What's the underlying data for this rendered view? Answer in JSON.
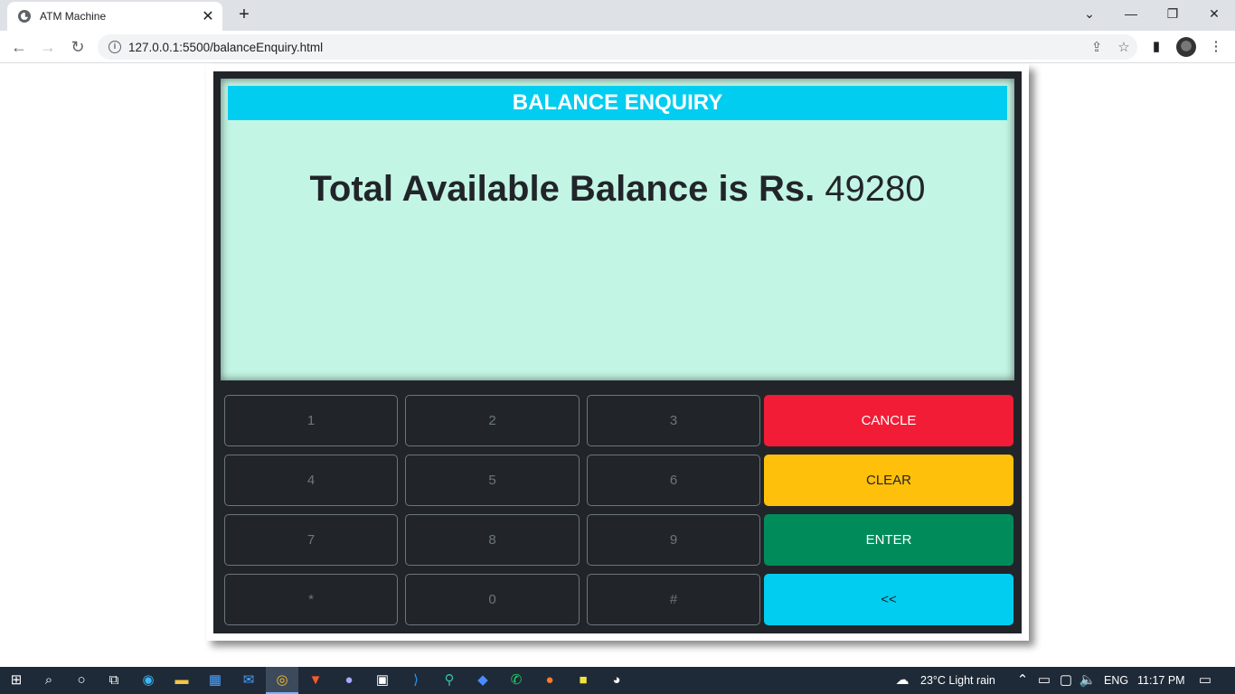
{
  "browser": {
    "tab_title": "ATM Machine",
    "url": "127.0.0.1:5500/balanceEnquiry.html"
  },
  "screen": {
    "title": "BALANCE ENQUIRY",
    "balance_label": "Total Available Balance is Rs.",
    "balance_value": "49280"
  },
  "keypad": {
    "keys": [
      "1",
      "2",
      "3",
      "4",
      "5",
      "6",
      "7",
      "8",
      "9",
      "*",
      "0",
      "#"
    ],
    "actions": {
      "cancel": "CANCLE",
      "clear": "CLEAR",
      "enter": "ENTER",
      "back": "<<"
    }
  },
  "taskbar": {
    "weather": "23°C  Light rain",
    "language": "ENG",
    "time": "11:17 PM"
  },
  "colors": {
    "screen_bg": "#c3f5e4",
    "title_bg": "#00cdf0",
    "cancel": "#f21c36",
    "clear": "#fec00a",
    "enter": "#008c5a",
    "back": "#00cdf0"
  }
}
